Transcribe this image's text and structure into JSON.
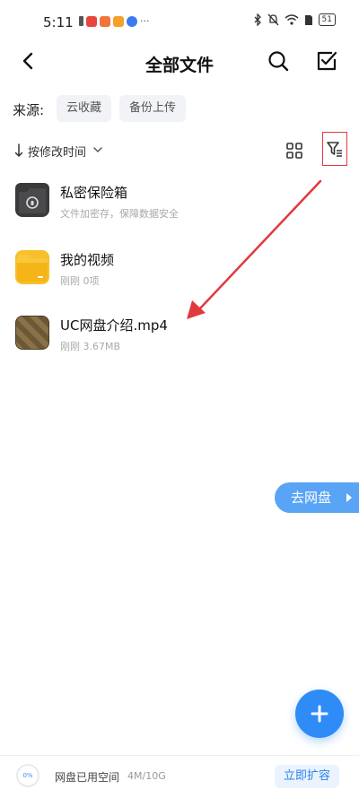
{
  "status_bar": {
    "time": "5:11",
    "more": "···",
    "battery": "51",
    "app_icon_colors": [
      "#e8453c",
      "#f0763a",
      "#f3a12b",
      "#3a7bf0"
    ]
  },
  "header": {
    "title": "全部文件",
    "back_icon": "back-chevron-icon",
    "search_icon": "search-icon",
    "select_icon": "checkbox-edit-icon"
  },
  "source": {
    "label": "来源:",
    "chips": [
      "云收藏",
      "备份上传"
    ]
  },
  "sort": {
    "label": "按修改时间",
    "grid_icon": "grid-view-icon",
    "filter_icon": "filter-icon"
  },
  "files": [
    {
      "name": "私密保险箱",
      "meta": "文件加密存，保障数据安全",
      "icon": "safe-icon"
    },
    {
      "name": "我的视频",
      "meta": "刚刚  0项",
      "icon": "folder-icon"
    },
    {
      "name": "UC网盘介绍.mp4",
      "meta": "刚刚  3.67MB",
      "icon": "video-thumbnail"
    }
  ],
  "go_drive": {
    "label": "去网盘"
  },
  "storage": {
    "percent": "0%",
    "label": "网盘已用空间",
    "value": "4M/10G",
    "expand_label": "立即扩容"
  },
  "colors": {
    "accent": "#2f8cf6",
    "highlight": "#e0393e",
    "folder": "#f7c02a"
  }
}
